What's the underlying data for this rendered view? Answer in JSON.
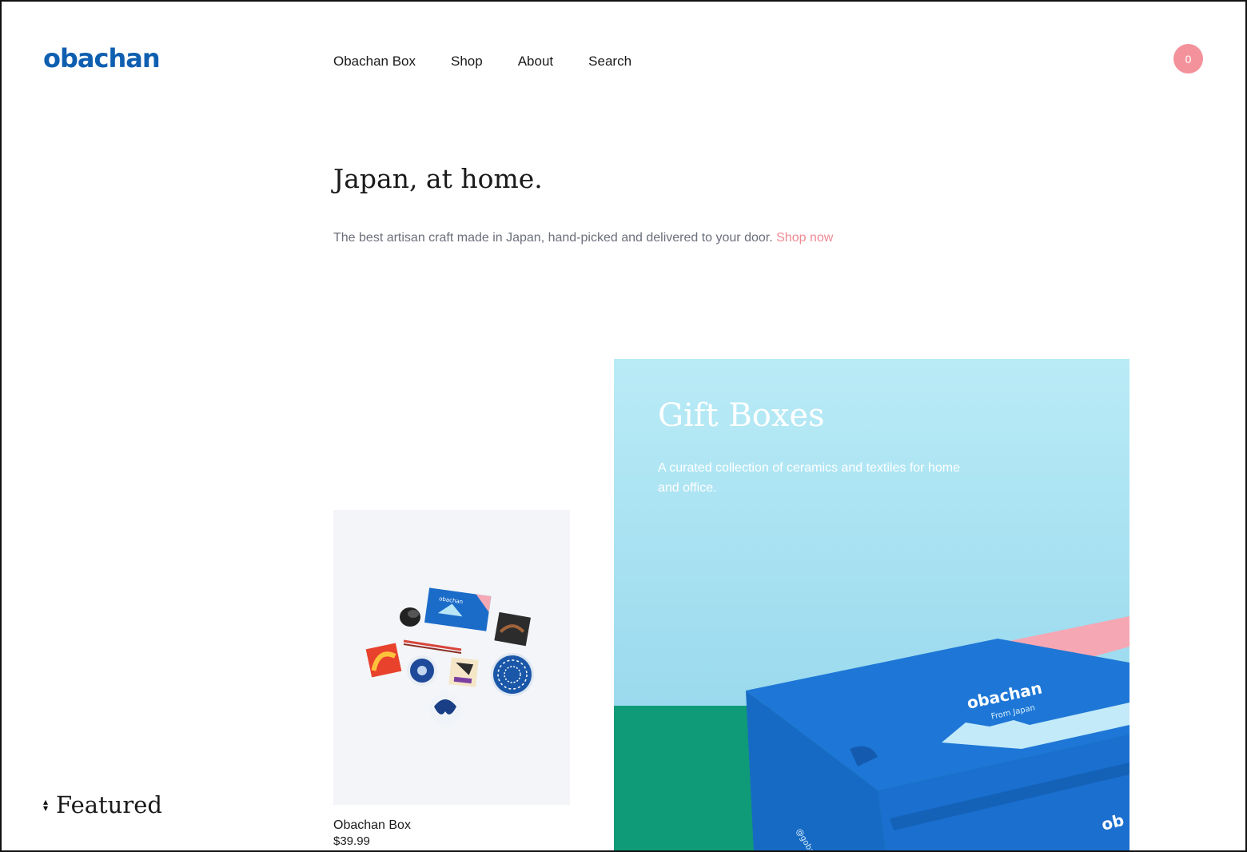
{
  "header": {
    "logo": "obachan",
    "nav": [
      "Obachan Box",
      "Shop",
      "About",
      "Search"
    ],
    "cart_count": "0"
  },
  "hero": {
    "title": "Japan, at home.",
    "subtitle": "The best artisan craft made in Japan, hand-picked and delivered to your door.",
    "cta": "Shop now"
  },
  "product": {
    "name": "Obachan Box",
    "price": "$39.99",
    "image_icon": "product-flatlay-image",
    "box_text": "obachan"
  },
  "gift": {
    "title": "Gift Boxes",
    "description": "A curated collection of ceramics and textiles for home and office.",
    "box_brand": "obachan",
    "box_sub": "From Japan",
    "box_side": "@gobachan",
    "box_front": "ob"
  },
  "sort": {
    "label": "Featured",
    "icon": "sort-icon"
  },
  "colors": {
    "brand": "#0f5fb0",
    "accent": "#f08a95",
    "cart": "#f4929c"
  }
}
